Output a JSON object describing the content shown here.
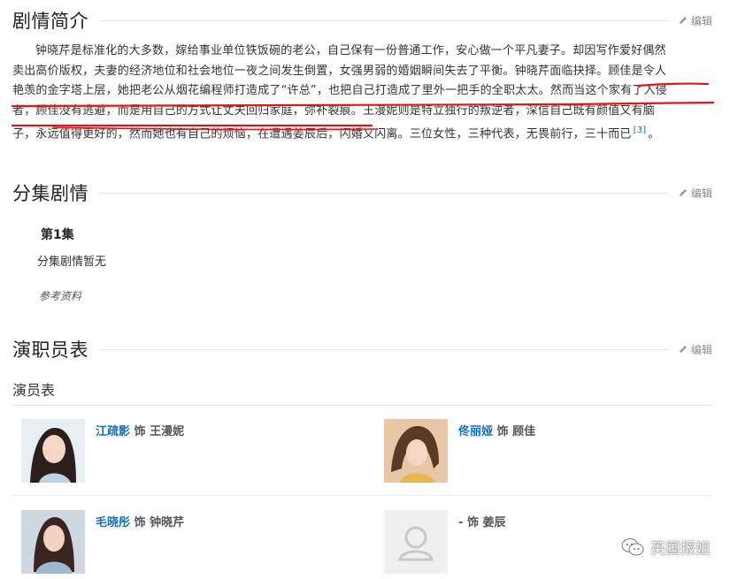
{
  "synopsis": {
    "title": "剧情简介",
    "edit": "编辑",
    "text_lines": [
      "钟晓芹是标准化的大多数，嫁给事业单位铁饭碗的老公，自己保有一份普通工作，安心做一个平凡妻子。却因写作爱好偶然",
      "卖出高价版权，夫妻的经济地位和社会地位一夜之间发生倒置，女强男弱的婚姻瞬间失去了平衡。钟晓芹面临抉择。顾佳是令人",
      "艳羡的金字塔上层，她把老公从烟花编程师打造成了“许总”，也把自己打造成了里外一把手的全职太太。然而当这个家有了入侵",
      "者，顾佳没有逃避，而是用自己的方式让丈夫回归家庭，弥补裂痕。王漫妮则是特立独行的叛逆者，深信自己既有颜值又有脑",
      "子，永远值得更好的，然而她也有自己的烦恼，在遭遇姜辰后，闪婚又闪离。三位女性，三种代表，无畏前行，三十而已"
    ],
    "citation": "[3]",
    "end": "。"
  },
  "episodes": {
    "title": "分集剧情",
    "edit": "编辑",
    "episode_title": "第1集",
    "episode_desc": "分集剧情暂无",
    "reference": "参考资料"
  },
  "cast": {
    "title": "演职员表",
    "edit": "编辑",
    "subtitle": "演员表",
    "role_sep": "饰",
    "actors": [
      {
        "name": "江疏影",
        "role": "王漫妮"
      },
      {
        "name": "佟丽娅",
        "role": "顾佳"
      },
      {
        "name": "毛晓彤",
        "role": "钟晓芹"
      },
      {
        "name": "-",
        "role": "姜辰"
      }
    ]
  },
  "watermark": "英国报姐",
  "colors": {
    "link": "#136ec2",
    "annotation": "#e0161b"
  }
}
